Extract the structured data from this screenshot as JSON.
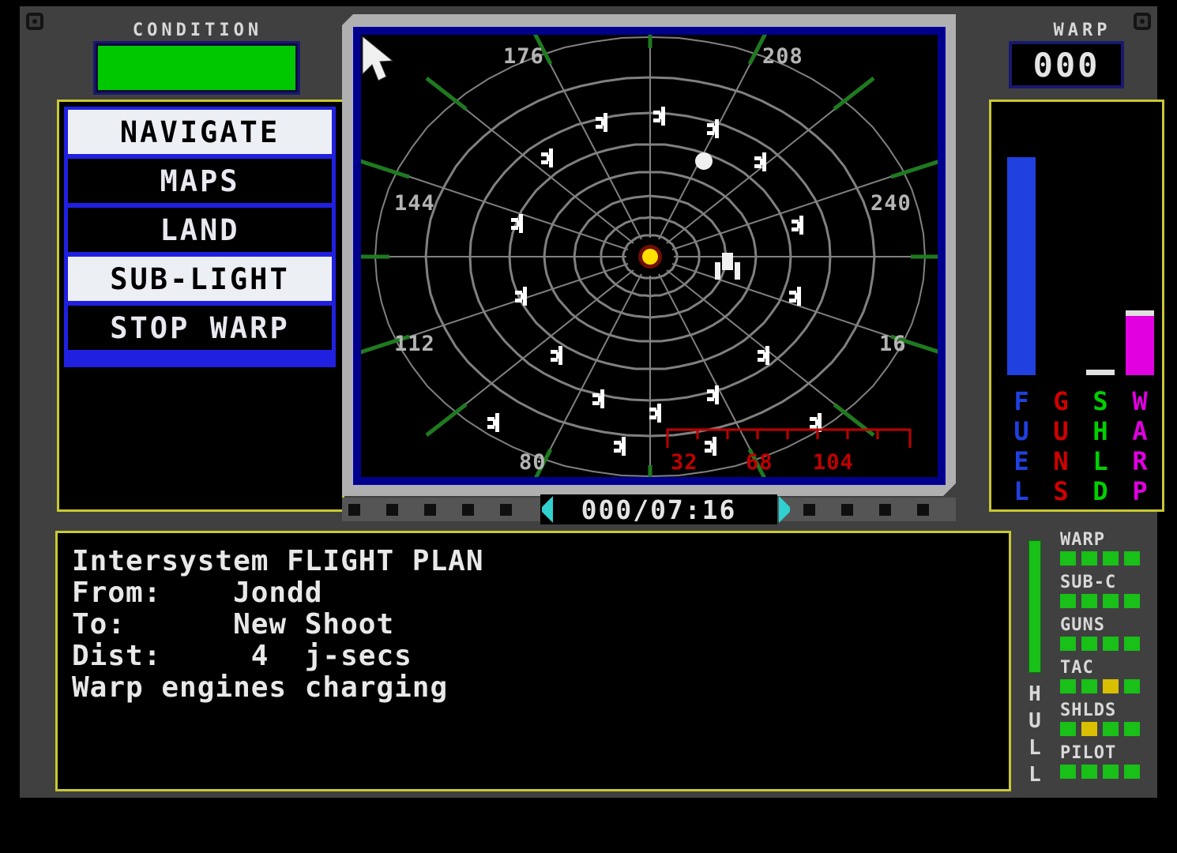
{
  "left_panel": {
    "condition_label": "CONDITION",
    "condition_color": "#00c800",
    "condition_value": 100,
    "menu": [
      {
        "label": "NAVIGATE",
        "selected": true
      },
      {
        "label": "MAPS",
        "selected": false
      },
      {
        "label": "LAND",
        "selected": false
      },
      {
        "label": "SUB-LIGHT",
        "selected": true
      },
      {
        "label": "STOP WARP",
        "selected": false
      }
    ]
  },
  "radar": {
    "bearing_labels": [
      "176",
      "208",
      "144",
      "240",
      "112",
      "16",
      "80"
    ],
    "range_scale_labels": [
      "32",
      "68",
      "104"
    ],
    "range_scale_color": "#c00000",
    "grid_color": "#808080",
    "trim_color": "#1f7a1f",
    "sun_color": "#ffe000",
    "blip_color": "#ffffff",
    "clock": "000/07:16",
    "clock_arrow_color": "#30d0d0"
  },
  "right_panel": {
    "warp_label": "WARP",
    "warp_value": "000",
    "gauges": [
      {
        "name": "FUEL",
        "color": "#2040e0",
        "value": 92,
        "cap": false
      },
      {
        "name": "GUNS",
        "color": "#d00000",
        "value": 0,
        "cap": false
      },
      {
        "name": "SHLD",
        "color": "#00d000",
        "value": 0,
        "cap": true
      },
      {
        "name": "WARP",
        "color": "#e000e0",
        "value": 25,
        "cap": true
      }
    ]
  },
  "flight_plan": {
    "lines": [
      "Intersystem FLIGHT PLAN",
      "From:    Jondd",
      "To:      New Shoot",
      "Dist:     4  j-secs",
      "Warp engines charging"
    ]
  },
  "status": {
    "hull_label": "HULL",
    "hull_value": 100,
    "hull_color": "#18c018",
    "systems": [
      {
        "name": "WARP",
        "leds": [
          "ok",
          "ok",
          "ok",
          "ok"
        ]
      },
      {
        "name": "SUB-C",
        "leds": [
          "ok",
          "ok",
          "ok",
          "ok"
        ]
      },
      {
        "name": "GUNS",
        "leds": [
          "ok",
          "ok",
          "ok",
          "ok"
        ]
      },
      {
        "name": "TAC",
        "leds": [
          "ok",
          "ok",
          "warn",
          "ok"
        ]
      },
      {
        "name": "SHLDS",
        "leds": [
          "ok",
          "warn",
          "ok",
          "ok"
        ]
      },
      {
        "name": "PILOT",
        "leds": [
          "ok",
          "ok",
          "ok",
          "ok"
        ]
      }
    ]
  }
}
